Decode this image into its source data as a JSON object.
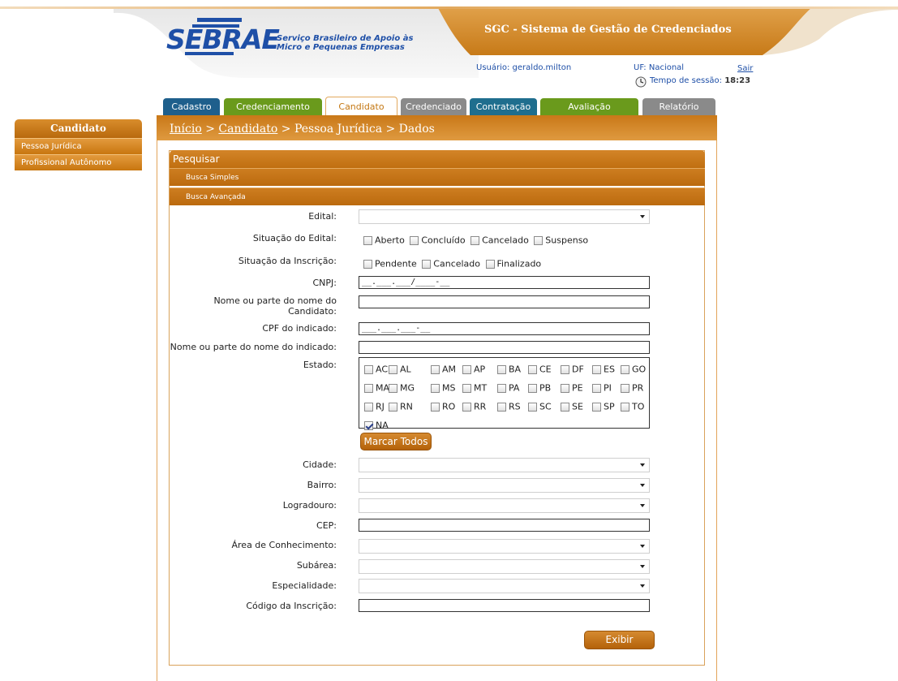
{
  "header": {
    "logo_word": "SEBRAE",
    "logo_tagline_1": "Serviço Brasileiro de Apoio às",
    "logo_tagline_2": "Micro e Pequenas Empresas",
    "system_title": "SGC - Sistema de Gestão de Credenciados",
    "user_label": "Usuário: geraldo.milton",
    "uf_label": "UF: Nacional",
    "logout_label": "Sair",
    "session_label": "Tempo de sessão:",
    "session_value": "18:23"
  },
  "tabs": [
    {
      "label": "Cadastro",
      "color": "#1e5f8c"
    },
    {
      "label": "Credenciamento",
      "color": "#6a9a1c"
    },
    {
      "label": "Candidato",
      "color": "#ffffff",
      "active": true
    },
    {
      "label": "Credenciado",
      "color": "#8a8a8a"
    },
    {
      "label": "Contratação",
      "color": "#1f6e8e"
    },
    {
      "label": "Avaliação",
      "color": "#6a9a1c"
    },
    {
      "label": "Relatório",
      "color": "#8a8a8a"
    }
  ],
  "sidebar": {
    "title": "Candidato",
    "items": [
      {
        "label": "Pessoa Jurídica"
      },
      {
        "label": "Profissional Autônomo"
      }
    ]
  },
  "breadcrumb": {
    "home": "Início",
    "sep1": " > ",
    "candidate": "Candidato",
    "rest": " > Pessoa Jurídica > Dados"
  },
  "search": {
    "title": "Pesquisar",
    "simple_label": "Busca Simples",
    "advanced_label": "Busca Avançada"
  },
  "form": {
    "edital_label": "Edital:",
    "situacao_edital_label": "Situação do Edital:",
    "situacao_edital_options": [
      "Aberto",
      "Concluído",
      "Cancelado",
      "Suspenso"
    ],
    "situacao_inscricao_label": "Situação da Inscrição:",
    "situacao_inscricao_options": [
      "Pendente",
      "Cancelado",
      "Finalizado"
    ],
    "cnpj_label": "CNPJ:",
    "cnpj_value": "__.___.___/____-__",
    "nome_candidato_label_1": "Nome ou parte do nome do",
    "nome_candidato_label_2": "Candidato:",
    "cpf_label": "CPF do indicado:",
    "cpf_value": "___.___.___-__",
    "nome_indicado_label": "Nome ou parte do nome do indicado:",
    "estado_label": "Estado:",
    "estados": [
      "AC",
      "AL",
      "AM",
      "AP",
      "BA",
      "CE",
      "DF",
      "ES",
      "GO",
      "MA",
      "MG",
      "MS",
      "MT",
      "PA",
      "PB",
      "PE",
      "PI",
      "PR",
      "RJ",
      "RN",
      "RO",
      "RR",
      "RS",
      "SC",
      "SE",
      "SP",
      "TO",
      "NA"
    ],
    "estado_checked": "NA",
    "marcar_todos_label": "Marcar Todos",
    "cidade_label": "Cidade:",
    "bairro_label": "Bairro:",
    "logradouro_label": "Logradouro:",
    "cep_label": "CEP:",
    "area_label": "Área de Conhecimento:",
    "subarea_label": "Subárea:",
    "especialidade_label": "Especialidade:",
    "codigo_label": "Código da Inscrição:",
    "exibir_label": "Exibir"
  }
}
